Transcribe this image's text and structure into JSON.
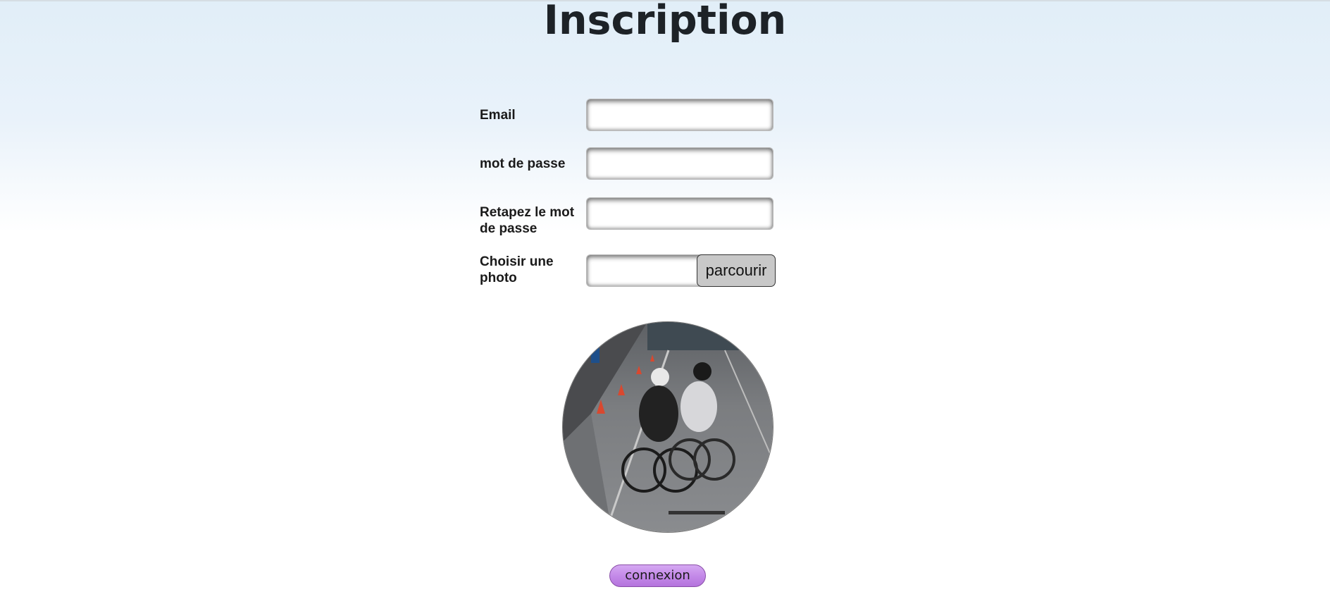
{
  "page": {
    "title": "Inscription"
  },
  "form": {
    "email": {
      "label": "Email",
      "value": "",
      "placeholder": ""
    },
    "password": {
      "label": "mot de passe",
      "value": "",
      "placeholder": ""
    },
    "password_confirm": {
      "label": "Retapez le mot de passe",
      "value": "",
      "placeholder": ""
    },
    "photo": {
      "label": "Choisir une photo",
      "browse_label": "parcourir",
      "value": ""
    }
  },
  "preview": {
    "image_alt": "photo-preview"
  },
  "submit": {
    "label": "connexion"
  },
  "colors": {
    "background_top": "#e1eef8",
    "title": "#1d2227",
    "submit_button": "#c48ae8",
    "browse_button": "#c8c8c8"
  }
}
